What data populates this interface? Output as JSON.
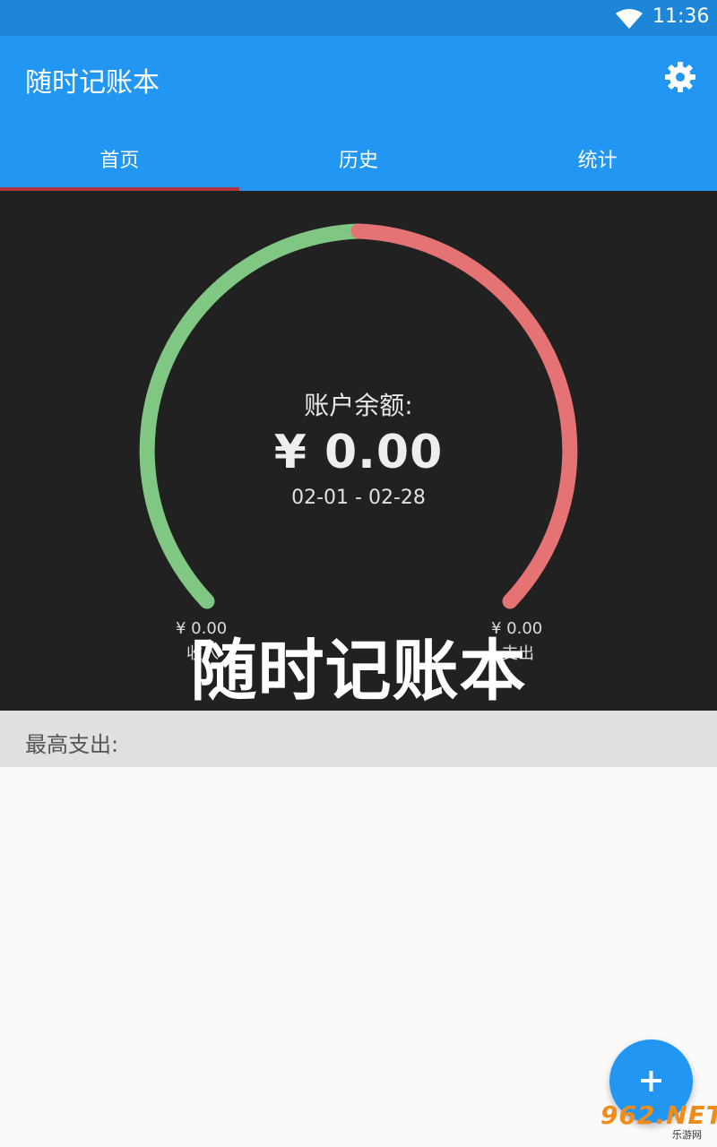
{
  "status_bar": {
    "time": "11:36",
    "wifi_icon": "wifi-icon"
  },
  "app_bar": {
    "title": "随时记账本",
    "settings_icon": "gear-icon"
  },
  "tabs": [
    {
      "label": "首页",
      "active": true
    },
    {
      "label": "历史",
      "active": false
    },
    {
      "label": "统计",
      "active": false
    }
  ],
  "summary": {
    "balance_label": "账户余额:",
    "balance_value": "¥ 0.00",
    "period": "02-01 - 02-28",
    "income_amount": "¥ 0.00",
    "income_label": "收入",
    "expense_amount": "¥ 0.00",
    "expense_label": "支出",
    "gauge_colors": {
      "income": "#81c784",
      "expense": "#e57373"
    }
  },
  "overlay_title": "随时记账本",
  "max_expense": {
    "label": "最高支出:"
  },
  "fab": {
    "icon": "plus-icon"
  },
  "logo": {
    "text": "962.NET",
    "sub": "乐游网"
  },
  "colors": {
    "primary": "#2196f3",
    "status_bar": "#1e86d8",
    "tab_indicator": "#b0353c",
    "panel": "#212121"
  }
}
